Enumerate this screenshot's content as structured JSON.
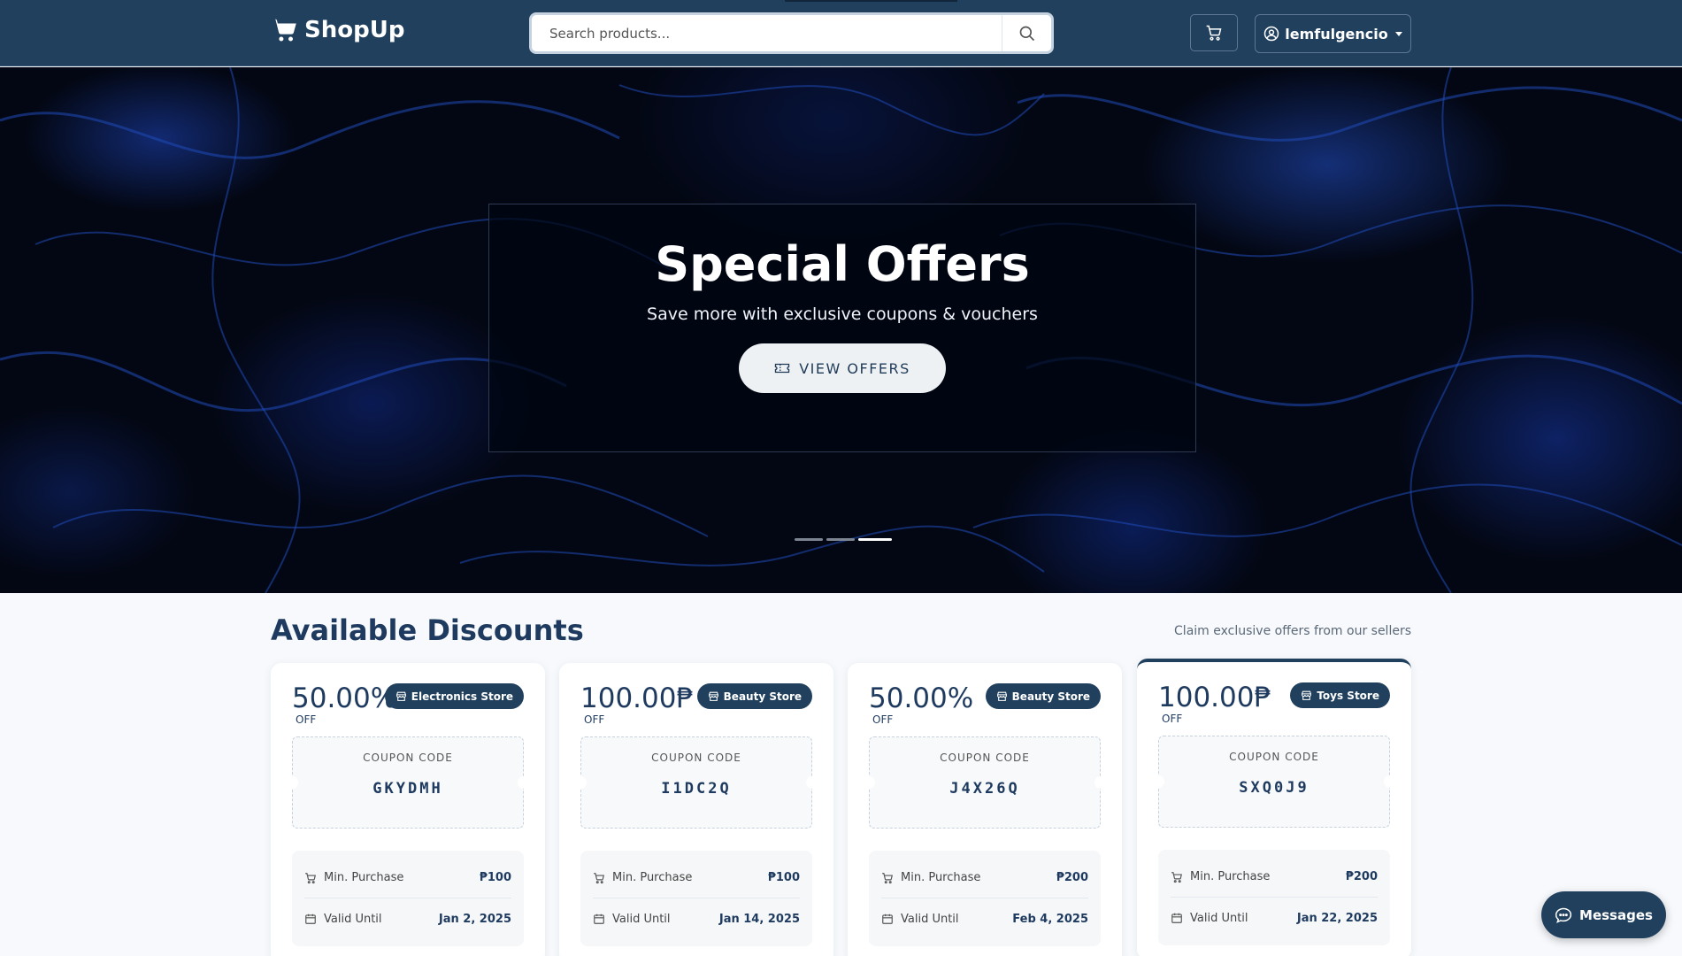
{
  "navbar": {
    "brand": "ShopUp",
    "search_placeholder": "Search products...",
    "username": "lemfulgencio"
  },
  "hero": {
    "title": "Special Offers",
    "subtitle": "Save more with exclusive coupons & vouchers",
    "button_label": "VIEW OFFERS",
    "slides": 3,
    "active_slide": 3
  },
  "discounts": {
    "title": "Available Discounts",
    "subtitle": "Claim exclusive offers from our sellers",
    "coupon_label": "COUPON CODE",
    "off_label": "OFF",
    "min_purchase_label": "Min. Purchase",
    "valid_until_label": "Valid Until",
    "cards": [
      {
        "amount": "50.00%",
        "store": "Electronics Store",
        "code": "GKYDMH",
        "min_purchase": "₱100",
        "valid_until": "Jan 2, 2025"
      },
      {
        "amount": "100.00₱",
        "store": "Beauty Store",
        "code": "I1DC2Q",
        "min_purchase": "₱100",
        "valid_until": "Jan 14, 2025"
      },
      {
        "amount": "50.00%",
        "store": "Beauty Store",
        "code": "J4X26Q",
        "min_purchase": "₱200",
        "valid_until": "Feb 4, 2025"
      },
      {
        "amount": "100.00₱",
        "store": "Toys Store",
        "code": "SXQ0J9",
        "min_purchase": "₱200",
        "valid_until": "Jan 22, 2025"
      }
    ]
  },
  "messages_label": "Messages",
  "colors": {
    "navbar": "#21405d",
    "accent": "#1e3a5f",
    "hero_blue": "#1e46be",
    "page_bg": "#f7f9fc"
  },
  "icons": {
    "brand": "shopping-cart-icon",
    "search": "search-icon",
    "cart": "cart-icon",
    "user": "user-circle-icon",
    "store": "store-icon",
    "ticket": "ticket-icon",
    "calendar": "calendar-icon",
    "chat": "chat-icon"
  }
}
